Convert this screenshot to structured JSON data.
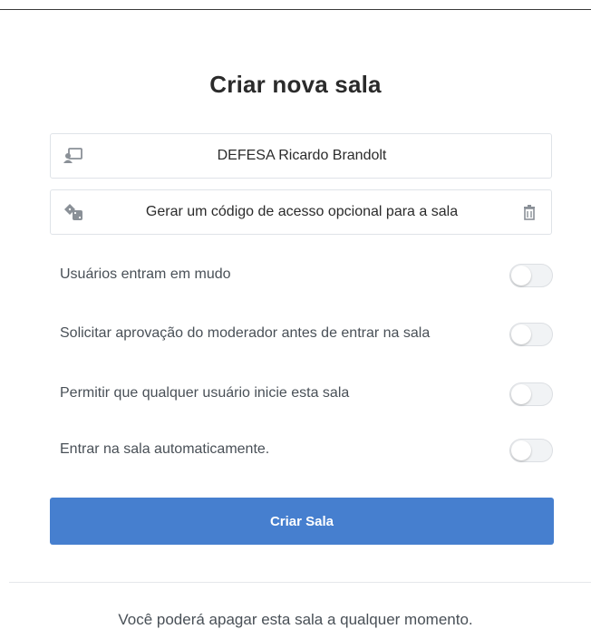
{
  "modal": {
    "title": "Criar nova sala",
    "room_name_field": {
      "value": "DEFESA Ricardo Brandolt",
      "icon": "room-icon"
    },
    "access_code_field": {
      "value": "Gerar um código de acesso opcional para a sala",
      "icon": "dice-icon",
      "action_icon": "trash-icon"
    },
    "options": [
      {
        "label": "Usuários entram em mudo",
        "enabled": false
      },
      {
        "label": "Solicitar aprovação do moderador antes de entrar na sala",
        "enabled": false
      },
      {
        "label": "Permitir que qualquer usuário inicie esta sala",
        "enabled": false
      },
      {
        "label": "Entrar na sala automaticamente.",
        "enabled": false
      }
    ],
    "submit_label": "Criar Sala",
    "footer_note": "Você poderá apagar esta sala a qualquer momento."
  },
  "colors": {
    "primary": "#467fcf",
    "title": "#2b2b2b",
    "text": "#495057",
    "toggle_off": "#f1f3f5"
  }
}
